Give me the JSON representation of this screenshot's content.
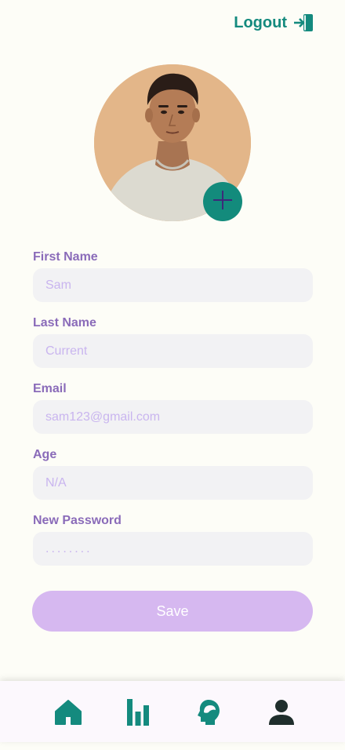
{
  "header": {
    "logout_label": "Logout",
    "logout_icon": "logout-icon"
  },
  "profile": {
    "avatar": "user-photo",
    "add_photo_icon": "plus-icon"
  },
  "form": {
    "fields": [
      {
        "label": "First Name",
        "placeholder": "Sam",
        "type": "text"
      },
      {
        "label": "Last Name",
        "placeholder": "Current",
        "type": "text"
      },
      {
        "label": "Email",
        "placeholder": "sam123@gmail.com",
        "type": "email"
      },
      {
        "label": "Age",
        "placeholder": "N/A",
        "type": "text"
      },
      {
        "label": "New Password",
        "placeholder": "........",
        "type": "password"
      }
    ],
    "save_label": "Save"
  },
  "navbar": {
    "items": [
      {
        "icon": "home-icon"
      },
      {
        "icon": "bar-chart-icon"
      },
      {
        "icon": "head-icon"
      },
      {
        "icon": "profile-icon"
      }
    ]
  },
  "colors": {
    "background": "#fdfdf7",
    "accent": "#148a7e",
    "label": "#8a6bb9",
    "input_bg": "#f2f2f4",
    "placeholder": "#c9b5ef",
    "save_button": "#d6b8f0",
    "navbar_bg": "#fcf8fd"
  }
}
